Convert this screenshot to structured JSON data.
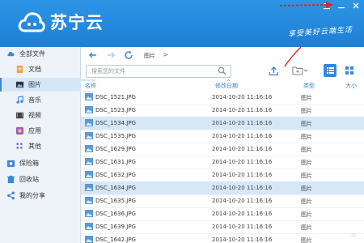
{
  "header": {
    "brand": "苏宁云",
    "slogan": "享受美好云端生活"
  },
  "sidebar": {
    "items": [
      {
        "label": "全部文件",
        "icon": "cloud-icon"
      },
      {
        "label": "文档",
        "icon": "document-icon"
      },
      {
        "label": "图片",
        "icon": "image-icon",
        "active": true
      },
      {
        "label": "音乐",
        "icon": "music-icon"
      },
      {
        "label": "视频",
        "icon": "video-icon"
      },
      {
        "label": "应用",
        "icon": "app-icon"
      },
      {
        "label": "其他",
        "icon": "other-icon"
      },
      {
        "label": "保险箱",
        "icon": "safe-icon"
      },
      {
        "label": "回收站",
        "icon": "trash-icon"
      },
      {
        "label": "我的分享",
        "icon": "share-icon"
      }
    ]
  },
  "toolbar": {
    "breadcrumb": "图片",
    "breadcrumb_sep": ">",
    "search_placeholder": "搜索您的文件"
  },
  "table": {
    "columns": {
      "name": "名称",
      "date": "修改日期",
      "type": "类型",
      "size": "大小"
    },
    "rows": [
      {
        "name": "DSC_1521.JPG",
        "date": "2014-10-20 11:16:16",
        "type": "图片"
      },
      {
        "name": "DSC_1523.JPG",
        "date": "2014-10-20 11:16:16",
        "type": "图片"
      },
      {
        "name": "DSC_1534.JPG",
        "date": "2014-10-20 11:16:16",
        "type": "图片",
        "selected": true
      },
      {
        "name": "DSC_1535.JPG",
        "date": "2014-10-20 11:16:16",
        "type": "图片"
      },
      {
        "name": "DSC_1629.JPG",
        "date": "2014-10-20 11:16:16",
        "type": "图片"
      },
      {
        "name": "DSC_1631.JPG",
        "date": "2014-10-20 11:16:16",
        "type": "图片"
      },
      {
        "name": "DSC_1632.JPG",
        "date": "2014-10-20 11:16:16",
        "type": "图片"
      },
      {
        "name": "DSC_1634.JPG",
        "date": "2014-10-20 11:16:16",
        "type": "图片",
        "selected": true
      },
      {
        "name": "DSC_1635.JPG",
        "date": "2014-10-20 11:16:16",
        "type": "图片"
      },
      {
        "name": "DSC_1636.JPG",
        "date": "2014-10-20 11:16:16",
        "type": "图片"
      },
      {
        "name": "DSC_1639.JPG",
        "date": "2014-10-20 11:16:16",
        "type": "图片"
      },
      {
        "name": "DSC_1642.JPG",
        "date": "2014-10-20 11:16:16",
        "type": "图片"
      }
    ]
  },
  "colors": {
    "header": "#1d7fd4",
    "accent": "#3a86d8",
    "selected_row": "#d6e8f8",
    "arrow": "#d8262b"
  }
}
